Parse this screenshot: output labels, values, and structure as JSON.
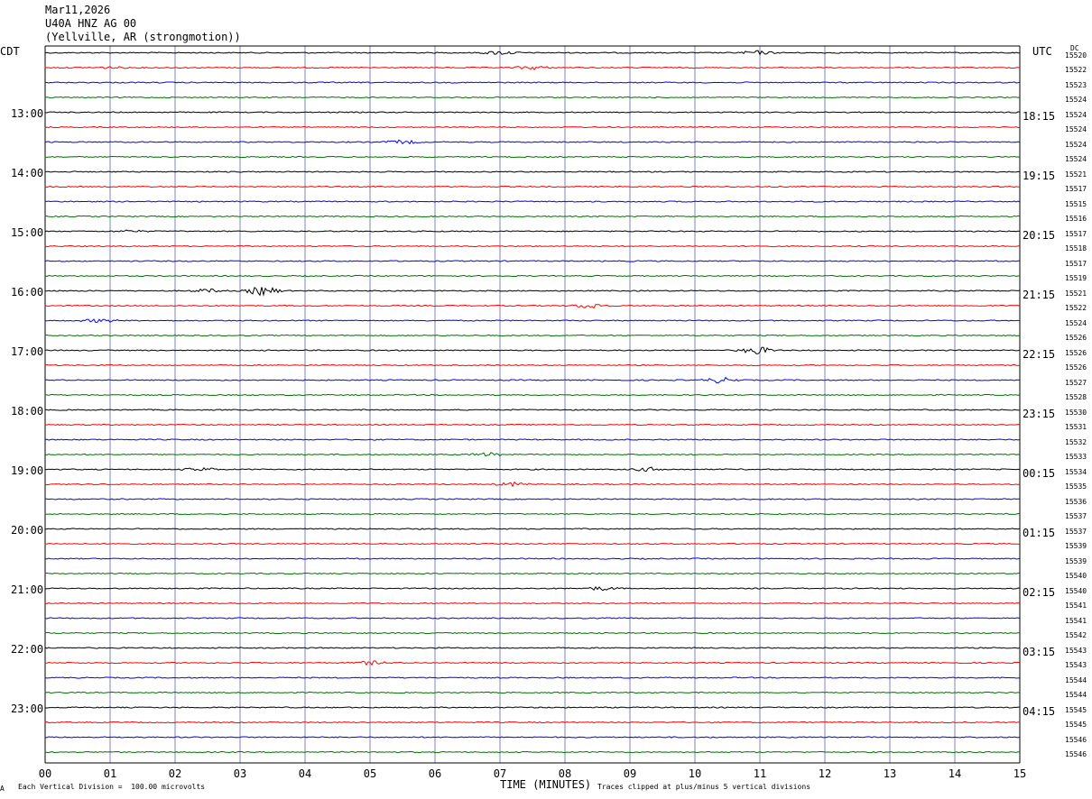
{
  "header": {
    "date": "Mar11,2026",
    "station": "U40A HNZ AG 00",
    "location": "(Yellville, AR (strongmotion))"
  },
  "left_zone_label": "CDT",
  "right_zone_label": "UTC",
  "dc_label": "DC",
  "footer": {
    "scale_note": "Each Vertical Division =  100.00 microvolts",
    "clip_note": "Traces clipped at plus/minus 5 vertical divisions",
    "corner_mark": "A"
  },
  "chart_data": {
    "type": "line",
    "xlabel": "TIME (MINUTES)",
    "xlim": [
      0,
      15
    ],
    "x_ticks": [
      "00",
      "01",
      "02",
      "03",
      "04",
      "05",
      "06",
      "07",
      "08",
      "09",
      "10",
      "11",
      "12",
      "13",
      "14",
      "15"
    ],
    "trace_colors": [
      "#000000",
      "#ff0000",
      "#0000ff",
      "#007000"
    ],
    "grid_color": "#8080c0",
    "left_time_labels": [
      "13:00",
      "14:00",
      "15:00",
      "16:00",
      "17:00",
      "18:00",
      "19:00",
      "20:00",
      "21:00",
      "22:00",
      "23:00"
    ],
    "right_time_labels": [
      "18:15",
      "19:15",
      "20:15",
      "21:15",
      "22:15",
      "23:15",
      "00:15",
      "01:15",
      "02:15",
      "03:15",
      "04:15"
    ],
    "dc_offsets": [
      "15520",
      "15522",
      "15523",
      "15524",
      "15524",
      "15524",
      "15524",
      "15524",
      "15521",
      "15517",
      "15515",
      "15516",
      "15517",
      "15518",
      "15517",
      "15519",
      "15521",
      "15522",
      "15524",
      "15526",
      "15526",
      "15526",
      "15527",
      "15528",
      "15530",
      "15531",
      "15532",
      "15533",
      "15534",
      "15535",
      "15536",
      "15537",
      "15537",
      "15539",
      "15539",
      "15540",
      "15540",
      "15541",
      "15541",
      "15542",
      "15543",
      "15543",
      "15544",
      "15544",
      "15545",
      "15545",
      "15546",
      "15546"
    ],
    "events": [
      {
        "trace": 0,
        "minute": 7.0,
        "amplitude": 2
      },
      {
        "trace": 0,
        "minute": 10.95,
        "amplitude": 2
      },
      {
        "trace": 1,
        "minute": 1.0,
        "amplitude": 1
      },
      {
        "trace": 1,
        "minute": 7.5,
        "amplitude": 2
      },
      {
        "trace": 6,
        "minute": 5.5,
        "amplitude": 2
      },
      {
        "trace": 12,
        "minute": 1.3,
        "amplitude": 1
      },
      {
        "trace": 16,
        "minute": 3.35,
        "amplitude": 5
      },
      {
        "trace": 16,
        "minute": 2.5,
        "amplitude": 2
      },
      {
        "trace": 17,
        "minute": 8.4,
        "amplitude": 3
      },
      {
        "trace": 18,
        "minute": 0.85,
        "amplitude": 2
      },
      {
        "trace": 20,
        "minute": 10.95,
        "amplitude": 4
      },
      {
        "trace": 22,
        "minute": 10.4,
        "amplitude": 3
      },
      {
        "trace": 27,
        "minute": 6.8,
        "amplitude": 2
      },
      {
        "trace": 28,
        "minute": 9.3,
        "amplitude": 2
      },
      {
        "trace": 28,
        "minute": 2.4,
        "amplitude": 2
      },
      {
        "trace": 29,
        "minute": 7.2,
        "amplitude": 2
      },
      {
        "trace": 36,
        "minute": 8.55,
        "amplitude": 2
      },
      {
        "trace": 41,
        "minute": 5.0,
        "amplitude": 2
      }
    ]
  }
}
